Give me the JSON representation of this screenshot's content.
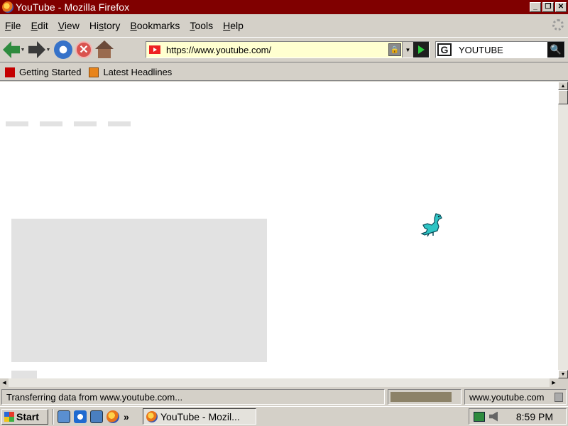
{
  "window": {
    "title": "YouTube - Mozilla Firefox",
    "controls": {
      "minimize": "_",
      "maximize": "❐",
      "close": "✕"
    }
  },
  "menu": {
    "items": [
      {
        "label": "File",
        "accel": "F"
      },
      {
        "label": "Edit",
        "accel": "E"
      },
      {
        "label": "View",
        "accel": "V"
      },
      {
        "label": "History",
        "accel": "s"
      },
      {
        "label": "Bookmarks",
        "accel": "B"
      },
      {
        "label": "Tools",
        "accel": "T"
      },
      {
        "label": "Help",
        "accel": "H"
      }
    ]
  },
  "navbar": {
    "url": "https://www.youtube.com/",
    "search_value": "YOUTUBE",
    "search_engine_icon": "G"
  },
  "bookmarks": {
    "items": [
      {
        "label": "Getting Started",
        "icon": "firefox-bookmark-icon"
      },
      {
        "label": "Latest Headlines",
        "icon": "rss-icon"
      }
    ]
  },
  "status": {
    "text": "Transferring data from www.youtube.com...",
    "domain": "www.youtube.com",
    "progress": 0.9
  },
  "taskbar": {
    "start_label": "Start",
    "chevron": "»",
    "task_label": "YouTube - Mozil...",
    "clock": "8:59 PM"
  },
  "colors": {
    "titlebar": "#800000",
    "url_background": "#ffffd0",
    "chrome": "#d4d0c8"
  }
}
